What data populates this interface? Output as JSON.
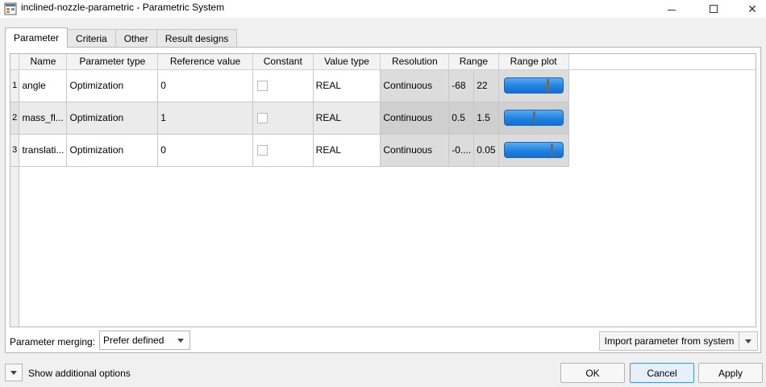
{
  "window": {
    "title": "inclined-nozzle-parametric - Parametric System",
    "app_icon": "app-grid-icon"
  },
  "tabs": [
    {
      "label": "Parameter",
      "active": true
    },
    {
      "label": "Criteria",
      "active": false
    },
    {
      "label": "Other",
      "active": false
    },
    {
      "label": "Result designs",
      "active": false
    }
  ],
  "table": {
    "headers": [
      "Name",
      "Parameter type",
      "Reference value",
      "Constant",
      "Value type",
      "Resolution",
      "Range",
      "Range plot"
    ],
    "rows": [
      {
        "num": "1",
        "name": "angle",
        "param_type": "Optimization",
        "ref_value": "0",
        "constant": false,
        "value_type": "REAL",
        "resolution": "Continuous",
        "range_min": "-68",
        "range_max": "22",
        "plot_fraction": 0.76
      },
      {
        "num": "2",
        "name": "mass_fl...",
        "param_type": "Optimization",
        "ref_value": "1",
        "constant": false,
        "value_type": "REAL",
        "resolution": "Continuous",
        "range_min": "0.5",
        "range_max": "1.5",
        "plot_fraction": 0.5
      },
      {
        "num": "3",
        "name": "translati...",
        "param_type": "Optimization",
        "ref_value": "0",
        "constant": false,
        "value_type": "REAL",
        "resolution": "Continuous",
        "range_min": "-0....",
        "range_max": "0.05",
        "plot_fraction": 0.82
      }
    ]
  },
  "merging": {
    "label": "Parameter merging:",
    "selected": "Prefer defined"
  },
  "import_button": "Import parameter from system",
  "footer": {
    "show_options": "Show additional options",
    "ok": "OK",
    "cancel": "Cancel",
    "apply": "Apply"
  },
  "colors": {
    "range_bar": "#1f82e2",
    "range_marker": "#6b6b6b",
    "cancel_focus": "#4a90d9"
  }
}
